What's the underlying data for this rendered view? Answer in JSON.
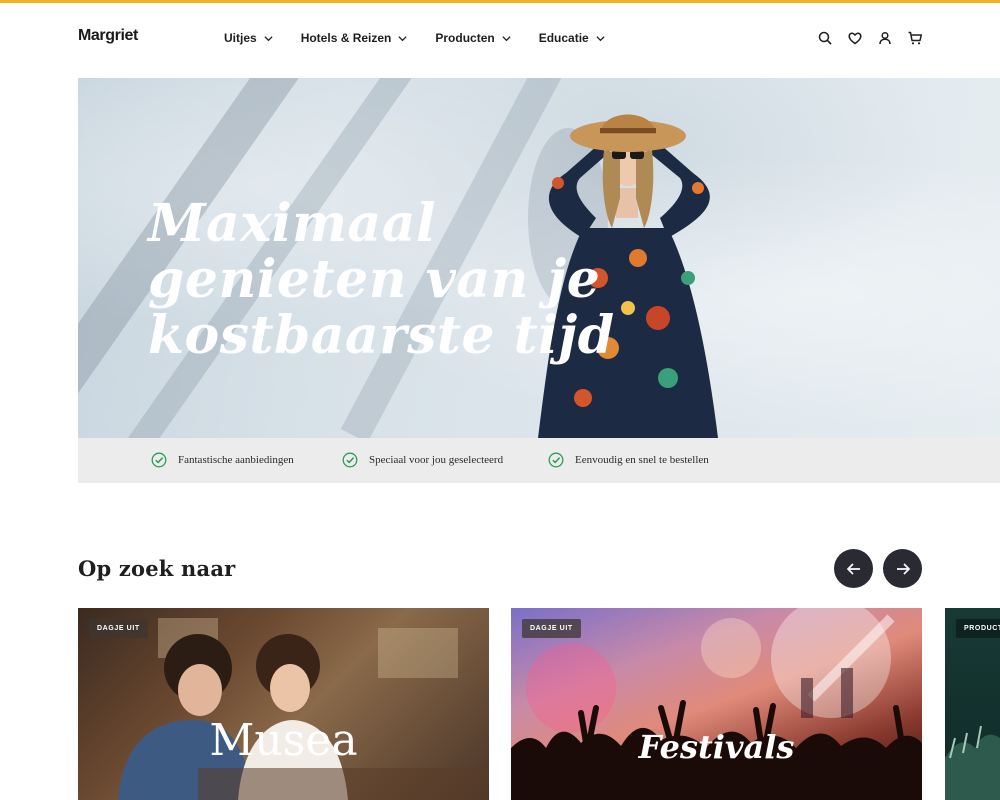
{
  "header": {
    "logo": "Margriet",
    "nav": [
      {
        "label": "Uitjes"
      },
      {
        "label": "Hotels & Reizen"
      },
      {
        "label": "Producten"
      },
      {
        "label": "Educatie"
      }
    ],
    "icons": [
      "search-icon",
      "heart-icon",
      "user-icon",
      "cart-icon"
    ]
  },
  "hero": {
    "title_lines": [
      "Maximaal",
      "genieten van je",
      "kostbaarste tijd"
    ]
  },
  "benefits": [
    {
      "text": "Fantastische aanbiedingen"
    },
    {
      "text": "Speciaal voor jou geselecteerd"
    },
    {
      "text": "Eenvoudig en snel te bestellen"
    }
  ],
  "section": {
    "title": "Op zoek naar"
  },
  "cards": [
    {
      "badge": "DAGJE UIT",
      "label": "Musea"
    },
    {
      "badge": "DAGJE UIT",
      "label": "Festivals"
    },
    {
      "badge": "PRODUCT"
    }
  ],
  "colors": {
    "accent": "#f2b31e",
    "check_green": "#2e9b57",
    "arrow_button": "#2a2a33",
    "benefit_strip": "#ececec"
  }
}
